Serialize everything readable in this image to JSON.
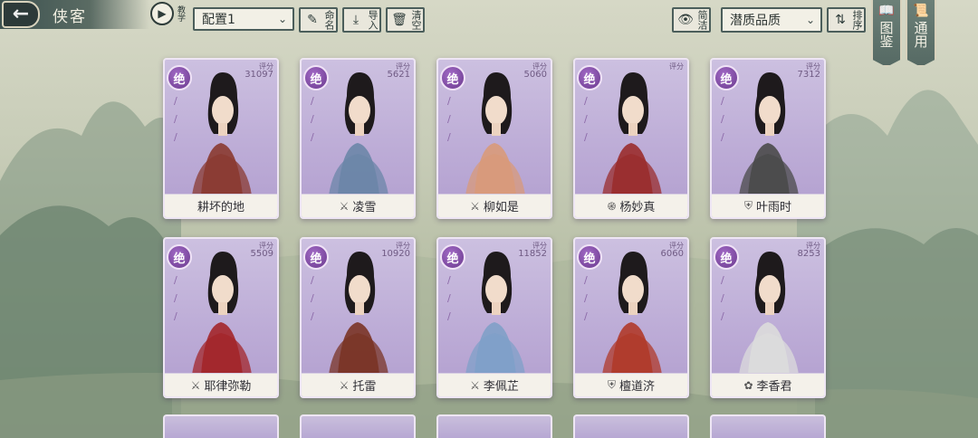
{
  "header": {
    "title": "侠客",
    "tutorial_label": "教学",
    "config_value": "配置1",
    "rename_label": "命名",
    "import_label": "导入",
    "clear_label": "清空",
    "concise_label": "简洁",
    "quality_value": "潜质品质",
    "sort_label": "排序"
  },
  "side_tabs": [
    {
      "label": "图鉴",
      "icon": "book-icon"
    },
    {
      "label": "通用",
      "icon": "scroll-icon"
    }
  ],
  "score_label": "评分",
  "grade_label": "绝",
  "cards": [
    {
      "name": "耕坏的地",
      "score": "31097",
      "school_icon": "",
      "accent": "#8a3a30"
    },
    {
      "name": "凌雪",
      "score": "5621",
      "school_icon": "sword-icon",
      "accent": "#6b86a8"
    },
    {
      "name": "柳如是",
      "score": "5060",
      "school_icon": "sword-icon",
      "accent": "#d89a7a"
    },
    {
      "name": "杨妙真",
      "score": "",
      "school_icon": "swirl-icon",
      "accent": "#9a2c2c"
    },
    {
      "name": "叶雨时",
      "score": "7312",
      "school_icon": "shield-icon",
      "accent": "#4a4a4a"
    },
    {
      "name": "耶律弥勒",
      "score": "5509",
      "school_icon": "sword-icon",
      "accent": "#a3262a"
    },
    {
      "name": "托雷",
      "score": "10920",
      "school_icon": "sword-icon",
      "accent": "#7a3426"
    },
    {
      "name": "李佩芷",
      "score": "11852",
      "school_icon": "sword-icon",
      "accent": "#7fa0c8"
    },
    {
      "name": "檀道济",
      "score": "6060",
      "school_icon": "shield-icon",
      "accent": "#b03a2a"
    },
    {
      "name": "李香君",
      "score": "8253",
      "school_icon": "lotus-icon",
      "accent": "#dcdcdc"
    }
  ]
}
